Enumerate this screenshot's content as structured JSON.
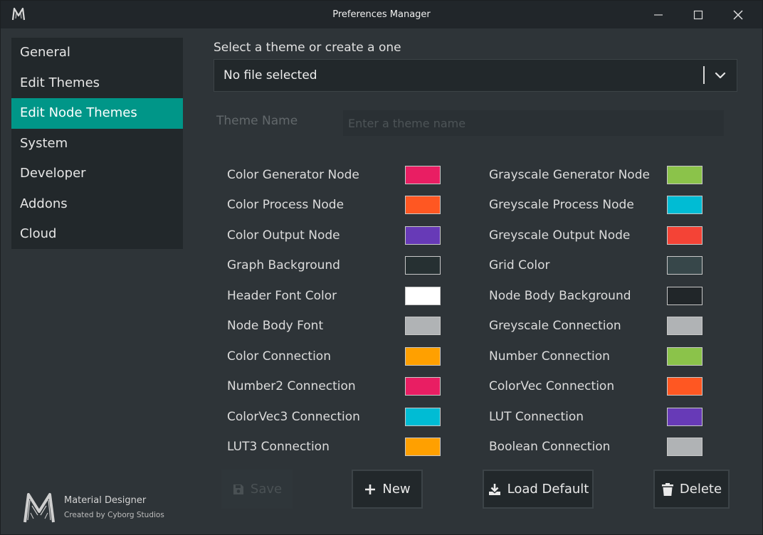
{
  "window": {
    "title": "Preferences Manager"
  },
  "sidebar": {
    "items": [
      {
        "label": "General",
        "active": false
      },
      {
        "label": "Edit Themes",
        "active": false
      },
      {
        "label": "Edit Node Themes",
        "active": true
      },
      {
        "label": "System",
        "active": false
      },
      {
        "label": "Developer",
        "active": false
      },
      {
        "label": "Addons",
        "active": false
      },
      {
        "label": "Cloud",
        "active": false
      }
    ]
  },
  "brand": {
    "name": "Material Designer",
    "subtitle": "Created by Cyborg Studios"
  },
  "theme_select": {
    "label": "Select a theme or create a one",
    "value": "No file selected"
  },
  "theme_name": {
    "label": "Theme Name",
    "placeholder": "Enter a theme name",
    "value": ""
  },
  "colors": {
    "left": [
      {
        "label": "Color Generator Node",
        "color": "#e91e63"
      },
      {
        "label": "Color Process Node",
        "color": "#ff5722"
      },
      {
        "label": "Color Output Node",
        "color": "#673ab7"
      },
      {
        "label": "Graph Background",
        "color": "#263032"
      },
      {
        "label": "Header Font Color",
        "color": "#ffffff"
      },
      {
        "label": "Node Body Font",
        "color": "#b0b3b5"
      },
      {
        "label": "Color Connection",
        "color": "#ffa000"
      },
      {
        "label": "Number2 Connection",
        "color": "#e91e63"
      },
      {
        "label": "ColorVec3 Connection",
        "color": "#00bcd4"
      },
      {
        "label": "LUT3 Connection",
        "color": "#ffa000"
      }
    ],
    "right": [
      {
        "label": "Grayscale Generator Node",
        "color": "#8bc34a"
      },
      {
        "label": "Greyscale Process Node",
        "color": "#00bcd4"
      },
      {
        "label": "Greyscale Output Node",
        "color": "#f44336"
      },
      {
        "label": "Grid Color",
        "color": "#37474a"
      },
      {
        "label": "Node Body Background",
        "color": "#212629"
      },
      {
        "label": "Greyscale Connection",
        "color": "#b0b3b5"
      },
      {
        "label": "Number Connection",
        "color": "#8bc34a"
      },
      {
        "label": "ColorVec Connection",
        "color": "#ff5722"
      },
      {
        "label": "LUT Connection",
        "color": "#673ab7"
      },
      {
        "label": "Boolean Connection",
        "color": "#b0b3b5"
      }
    ]
  },
  "buttons": {
    "save": {
      "label": "Save",
      "icon": "floppy-disk-icon",
      "enabled": false
    },
    "new": {
      "label": "New",
      "icon": "plus-icon",
      "enabled": true
    },
    "load_default": {
      "label": "Load Default",
      "icon": "download-icon",
      "enabled": true
    },
    "delete": {
      "label": "Delete",
      "icon": "trash-icon",
      "enabled": true
    }
  },
  "accent_color": "#009688"
}
